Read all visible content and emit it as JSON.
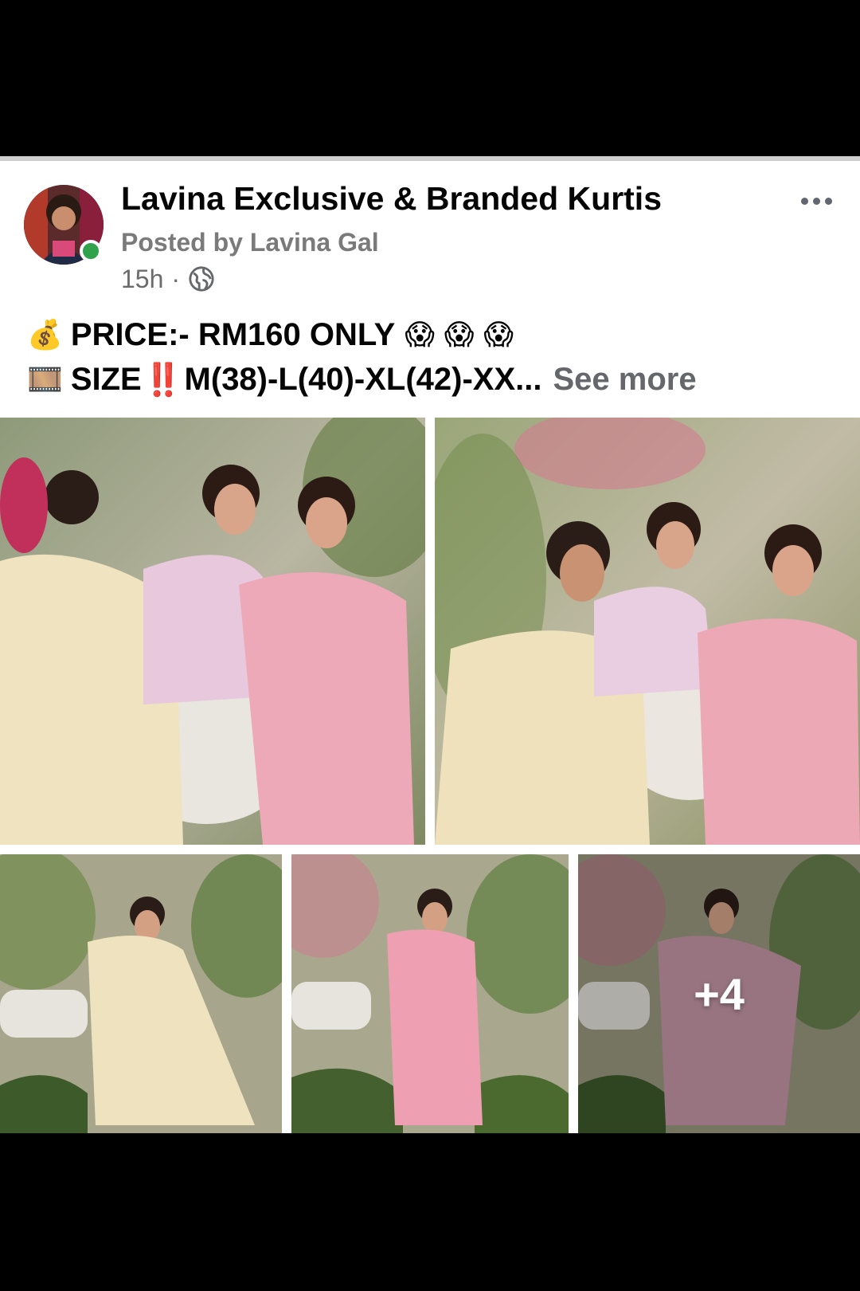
{
  "post": {
    "page_name": "Lavina Exclusive & Branded Kurtis",
    "posted_by": "Posted by Lavina Gal",
    "time": "15h",
    "separator": "·",
    "audience_icon": "globe-icon",
    "more_icon": "more-dots-icon",
    "text": {
      "line1": {
        "icon": "money-bag-emoji",
        "icon_glyph": "💰",
        "text": "PRICE:- RM160 ONLY",
        "trailing_emojis": [
          "😱",
          "😱",
          "😱"
        ]
      },
      "line2": {
        "icon": "film-strip-emoji",
        "icon_glyph": "🎞️",
        "label": "SIZE",
        "alert_glyph": "‼️",
        "text": "M(38)-L(40)-XL(42)-XX...",
        "see_more": "See more"
      }
    },
    "photos": {
      "count": 5,
      "more_overlay": "+4"
    }
  },
  "colors": {
    "page_background": "#000000",
    "card_background": "#ffffff",
    "online_indicator": "#31a24c",
    "secondary_text": "#65676b"
  }
}
